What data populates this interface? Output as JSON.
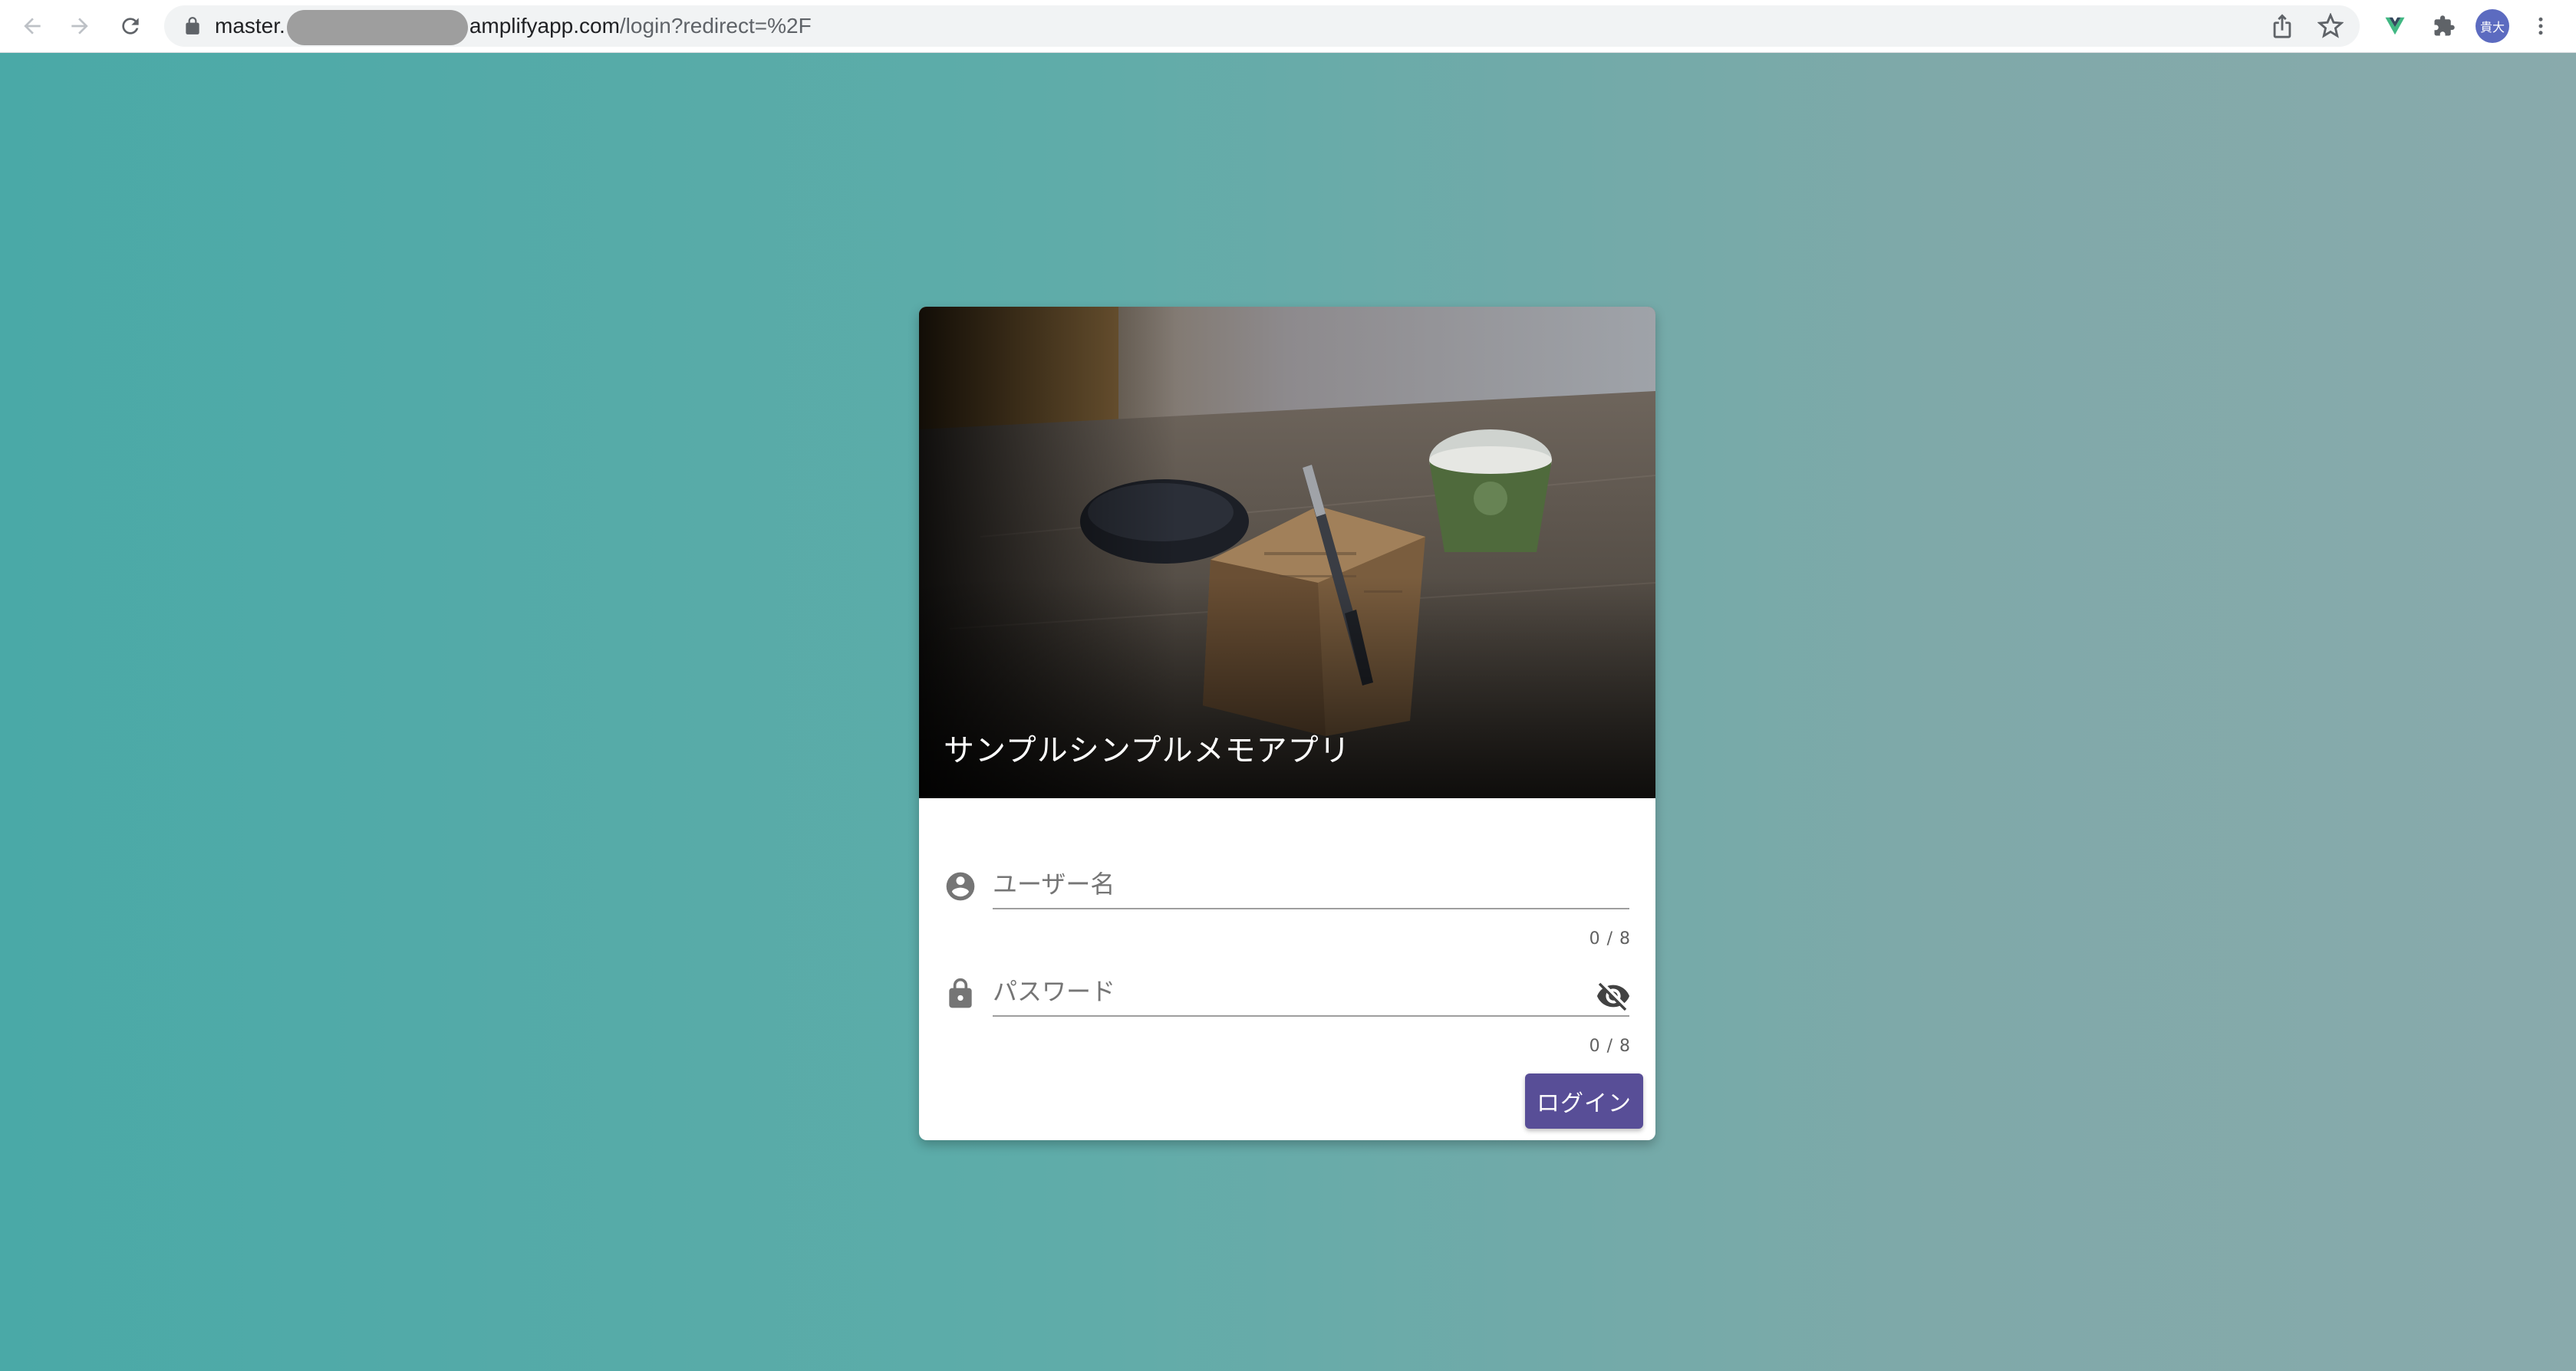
{
  "browser": {
    "url_prefix": "master.",
    "url_domain": "amplifyapp.com",
    "url_path": "/login?redirect=%2F",
    "avatar_text": "貴大"
  },
  "app": {
    "title": "サンプルシンプルメモアプリ",
    "username": {
      "placeholder": "ユーザー名",
      "value": "",
      "counter": "0 / 8"
    },
    "password": {
      "placeholder": "パスワード",
      "value": "",
      "counter": "0 / 8"
    },
    "login_label": "ログイン"
  },
  "icons": {
    "back": "arrow-back-icon",
    "forward": "arrow-forward-icon",
    "reload": "reload-icon",
    "lock": "lock-icon",
    "share": "share-icon",
    "bookmark": "star-icon",
    "vue_extension": "vue-icon",
    "extensions": "puzzle-icon",
    "menu": "kebab-menu-icon",
    "user": "account-circle-icon",
    "password": "lock-icon",
    "visibility": "eye-off-icon"
  },
  "colors": {
    "background_left": "#4aa9a7",
    "background_right": "#89aaac",
    "button": "#584e97",
    "card": "#ffffff"
  }
}
